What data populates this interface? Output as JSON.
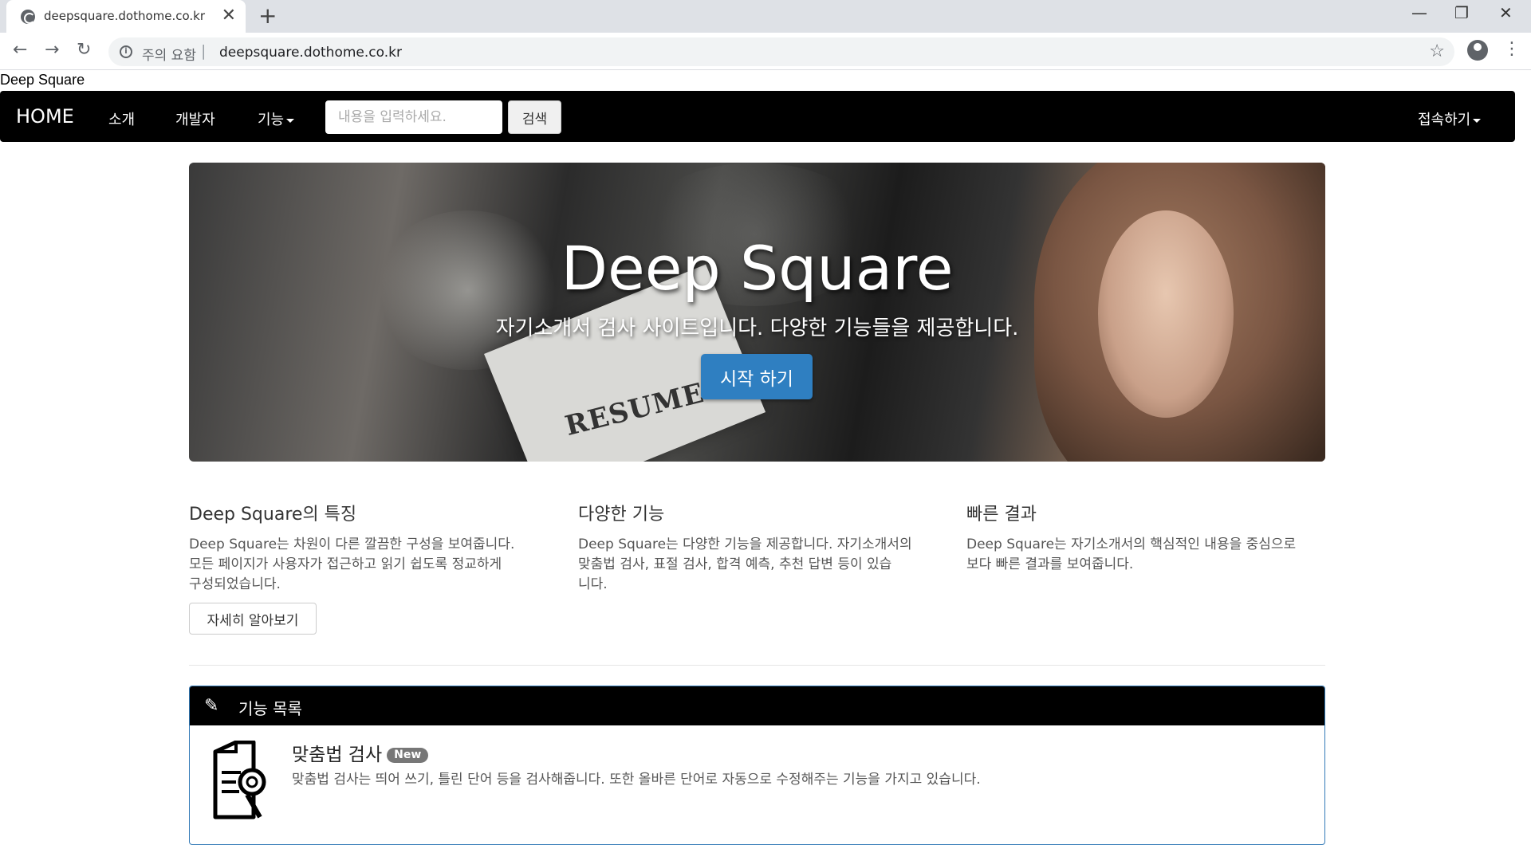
{
  "browser": {
    "tab_title": "deepsquare.dothome.co.kr",
    "tab_close": "✕",
    "new_tab": "+",
    "minimize": "—",
    "restore": "❐",
    "close": "✕",
    "back": "←",
    "forward": "→",
    "reload": "↻",
    "info_icon": "i",
    "security_warning": "주의 요함",
    "url_separator": "|",
    "url": "deepsquare.dothome.co.kr",
    "bookmark_star": "☆",
    "menu": "⋮"
  },
  "site": {
    "top_text": "Deep Square"
  },
  "navbar": {
    "brand": "HOME",
    "links": [
      "소개",
      "개발자",
      "기능"
    ],
    "search_placeholder": "내용을 입력하세요.",
    "search_button": "검색",
    "connect": "접속하기"
  },
  "hero": {
    "title": "Deep Square",
    "subtitle": "자기소개서 검사 사이트입니다. 다양한 기능들을 제공합니다.",
    "button": "시작 하기",
    "paper_text": "RESUME"
  },
  "features": [
    {
      "title": "Deep Square의 특징",
      "lines": [
        "Deep Square는 차원이 다른 깔끔한 구성을 보여줍니다.",
        "모든 페이지가 사용자가 접근하고 읽기 쉽도록 정교하게",
        "구성되었습니다."
      ]
    },
    {
      "title": "다양한 기능",
      "lines": [
        "Deep Square는 다양한 기능을 제공합니다. 자기소개서의",
        "맞춤법 검사, 표절 검사, 합격 예측, 추천 답변 등이 있습",
        "니다."
      ]
    },
    {
      "title": "빠른 결과",
      "lines": [
        "Deep Square는 자기소개서의 핵심적인 내용을 중심으로",
        "보다 빠른 결과를 보여줍니다."
      ]
    }
  ],
  "more_button": "자세히 알아보기",
  "panel": {
    "title": "기능 목록",
    "pencil_icon": "✎",
    "item": {
      "title": "맞춤법 검사",
      "badge": "New",
      "description": "맞춤법 검사는 띄어 쓰기, 틀린 단어 등을 검사해줍니다. 또한 올바른 단어로 자동으로 수정해주는 기능을 가지고 있습니다."
    }
  }
}
